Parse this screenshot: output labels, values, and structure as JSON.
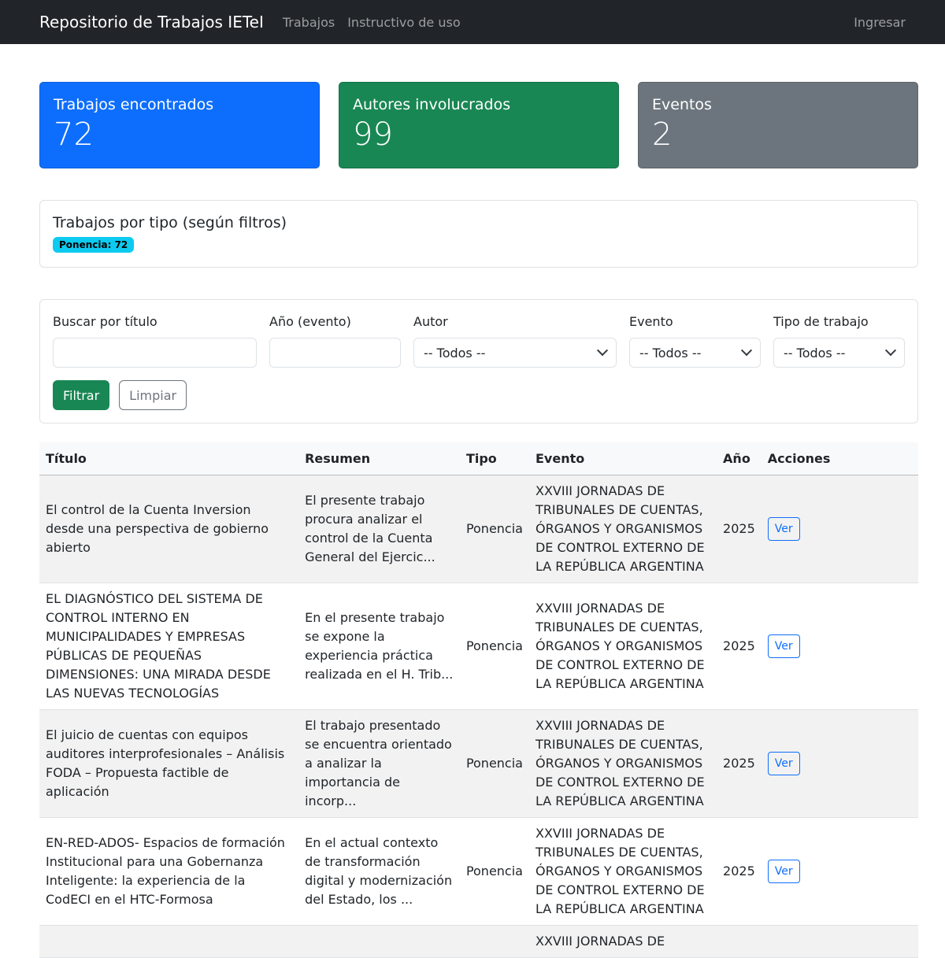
{
  "navbar": {
    "brand": "Repositorio de Trabajos IETeI",
    "links": [
      "Trabajos",
      "Instructivo de uso"
    ],
    "login": "Ingresar"
  },
  "stats": [
    {
      "title": "Trabajos encontrados",
      "value": "72",
      "color": "#0d6efd"
    },
    {
      "title": "Autores involucrados",
      "value": "99",
      "color": "#198754"
    },
    {
      "title": "Eventos",
      "value": "2",
      "color": "#6c757d"
    }
  ],
  "types": {
    "title": "Trabajos por tipo (según filtros)",
    "badge": "Ponencia: 72"
  },
  "filters": {
    "title_label": "Buscar por título",
    "title_value": "",
    "year_label": "Año (evento)",
    "year_value": "",
    "author_label": "Autor",
    "author_value": "-- Todos --",
    "event_label": "Evento",
    "event_value": "-- Todos --",
    "type_label": "Tipo de trabajo",
    "type_value": "-- Todos --",
    "filter_button": "Filtrar",
    "clear_button": "Limpiar"
  },
  "table": {
    "headers": [
      "Título",
      "Resumen",
      "Tipo",
      "Evento",
      "Año",
      "Acciones"
    ],
    "rows": [
      {
        "title": "El control de la Cuenta Inversion desde una perspectiva de gobierno abierto",
        "summary": "El presente trabajo procura analizar el control de la Cuenta General del Ejercic...",
        "type": "Ponencia",
        "event": "XXVIII JORNADAS DE TRIBUNALES DE CUENTAS, ÓRGANOS Y ORGANISMOS DE CONTROL EXTERNO DE LA REPÚBLICA ARGENTINA",
        "year": "2025",
        "action": "Ver"
      },
      {
        "title": "EL DIAGNÓSTICO DEL SISTEMA DE CONTROL INTERNO EN MUNICIPALIDADES Y EMPRESAS PÚBLICAS DE PEQUEÑAS DIMENSIONES: UNA MIRADA DESDE LAS NUEVAS TECNOLOGÍAS",
        "summary": "En el presente trabajo se expone la experiencia práctica realizada en el H. Trib...",
        "type": "Ponencia",
        "event": "XXVIII JORNADAS DE TRIBUNALES DE CUENTAS, ÓRGANOS Y ORGANISMOS DE CONTROL EXTERNO DE LA REPÚBLICA ARGENTINA",
        "year": "2025",
        "action": "Ver"
      },
      {
        "title": "El juicio de cuentas con equipos auditores interprofesionales – Análisis FODA – Propuesta factible de aplicación",
        "summary": "El trabajo presentado se encuentra orientado a analizar la importancia de incorp...",
        "type": "Ponencia",
        "event": "XXVIII JORNADAS DE TRIBUNALES DE CUENTAS, ÓRGANOS Y ORGANISMOS DE CONTROL EXTERNO DE LA REPÚBLICA ARGENTINA",
        "year": "2025",
        "action": "Ver"
      },
      {
        "title": "EN-RED-ADOS- Espacios de formación Institucional para una Gobernanza Inteligente: la experiencia de la CodECI en el HTC-Formosa",
        "summary": "En el actual contexto de transformación digital y modernización del Estado, los ...",
        "type": "Ponencia",
        "event": "XXVIII JORNADAS DE TRIBUNALES DE CUENTAS, ÓRGANOS Y ORGANISMOS DE CONTROL EXTERNO DE LA REPÚBLICA ARGENTINA",
        "year": "2025",
        "action": "Ver"
      },
      {
        "title": "",
        "summary": "",
        "type": "",
        "event": "XXVIII JORNADAS DE",
        "year": "",
        "action": ""
      }
    ]
  }
}
